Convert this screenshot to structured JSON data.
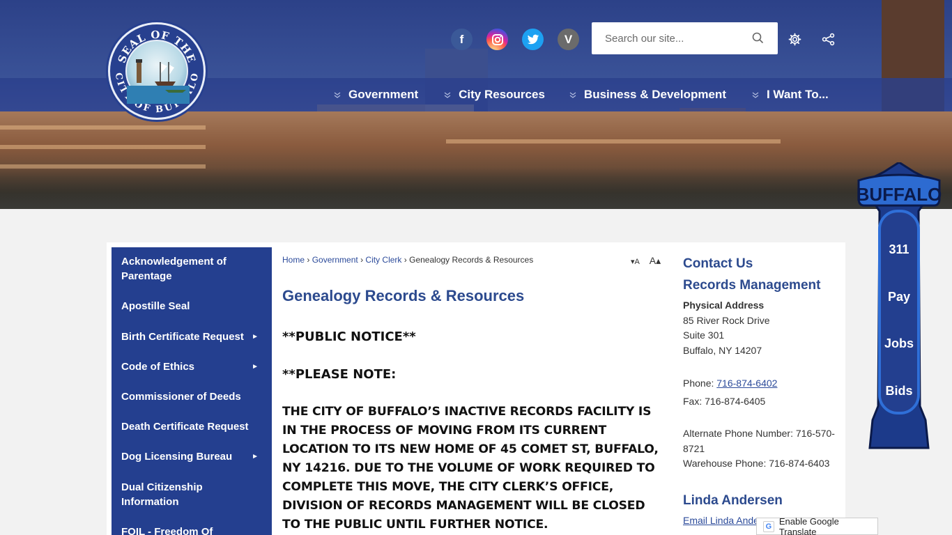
{
  "header": {
    "seal": {
      "top_text": "SEAL OF THE",
      "bottom_text": "CITY OF BUFFALO"
    },
    "social": [
      {
        "name": "facebook",
        "glyph": "f",
        "color": "#3b5998"
      },
      {
        "name": "instagram",
        "glyph": "◎",
        "color": "#d6249f"
      },
      {
        "name": "twitter",
        "glyph": "🐦",
        "color": "#1da1f2"
      },
      {
        "name": "vimeo",
        "glyph": "V",
        "color": "#6b6b6b"
      }
    ],
    "search": {
      "placeholder": "Search our site..."
    },
    "nav": [
      {
        "label": "Government"
      },
      {
        "label": "City Resources"
      },
      {
        "label": "Business & Development"
      },
      {
        "label": "I Want To..."
      }
    ]
  },
  "leftnav": {
    "items": [
      {
        "label": "Acknowledgement of Parentage",
        "arrow": ""
      },
      {
        "label": "Apostille Seal",
        "arrow": ""
      },
      {
        "label": "Birth Certificate Request",
        "arrow": "►"
      },
      {
        "label": "Code of Ethics",
        "arrow": "►"
      },
      {
        "label": "Commissioner of Deeds",
        "arrow": ""
      },
      {
        "label": "Death Certificate Request",
        "arrow": ""
      },
      {
        "label": "Dog Licensing Bureau",
        "arrow": "►"
      },
      {
        "label": "Dual Citizenship Information",
        "arrow": ""
      },
      {
        "label": "FOIL - Freedom Of",
        "arrow": ""
      }
    ]
  },
  "breadcrumb": {
    "home": "Home",
    "government": "Government",
    "city_clerk": "City Clerk",
    "current": "Genealogy Records & Resources",
    "sep": "›"
  },
  "textsize": {
    "smaller": "▾A",
    "larger": "A▴"
  },
  "main": {
    "title": "Genealogy Records & Resources",
    "notice1": "**PUBLIC NOTICE**",
    "notice2": "**PLEASE NOTE:",
    "notice_body": "THE CITY OF BUFFALO’S INACTIVE RECORDS FACILITY IS IN THE PROCESS OF MOVING FROM ITS CURRENT LOCATION TO ITS NEW HOME OF 45 COMET ST, BUFFALO, NY 14216. DUE TO THE VOLUME OF WORK REQUIRED TO COMPLETE THIS MOVE, THE CITY CLERK’S OFFICE, DIVISION OF RECORDS MANAGEMENT WILL BE CLOSED TO THE PUBLIC UNTIL FURTHER NOTICE."
  },
  "contact": {
    "heading": "Contact Us",
    "dept": "Records Management",
    "addr_label": "Physical Address",
    "addr1": "85 River Rock Drive",
    "addr2": "Suite 301",
    "addr3": "Buffalo, NY 14207",
    "phone_label": "Phone: ",
    "phone": "716-874-6402",
    "fax": "Fax: 716-874-6405",
    "alt_phone": "Alternate Phone Number: 716-570-8721",
    "warehouse": "Warehouse Phone: 716-874-6403",
    "person": "Linda Andersen",
    "email_link": "Email Linda Andersen"
  },
  "translate": {
    "label": "Enable Google Translate",
    "glyph": "G"
  },
  "widget": {
    "brand": "BUFFALO",
    "items": [
      "311",
      "Pay",
      "Jobs",
      "Bids"
    ]
  }
}
